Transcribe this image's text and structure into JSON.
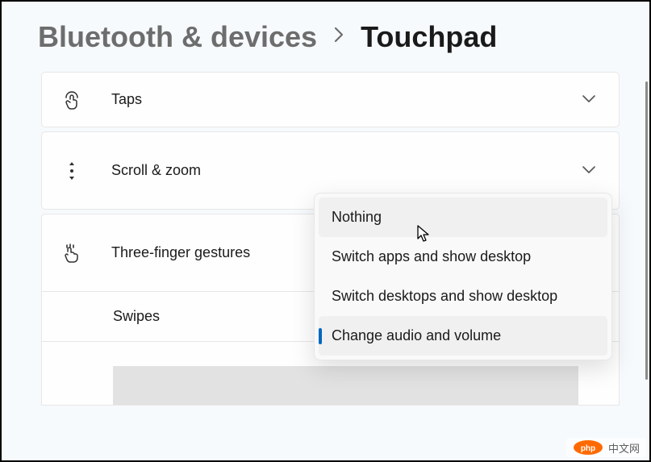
{
  "breadcrumb": {
    "parent": "Bluetooth & devices",
    "current": "Touchpad"
  },
  "sections": {
    "taps": {
      "label": "Taps"
    },
    "scrollzoom": {
      "label": "Scroll & zoom"
    },
    "threefinger": {
      "label": "Three-finger gestures"
    },
    "swipes": {
      "label": "Swipes"
    }
  },
  "dropdown": {
    "items": [
      {
        "label": "Nothing"
      },
      {
        "label": "Switch apps and show desktop"
      },
      {
        "label": "Switch desktops and show desktop"
      },
      {
        "label": "Change audio and volume"
      }
    ]
  },
  "watermark": {
    "brand": "php",
    "text": "中文网"
  }
}
